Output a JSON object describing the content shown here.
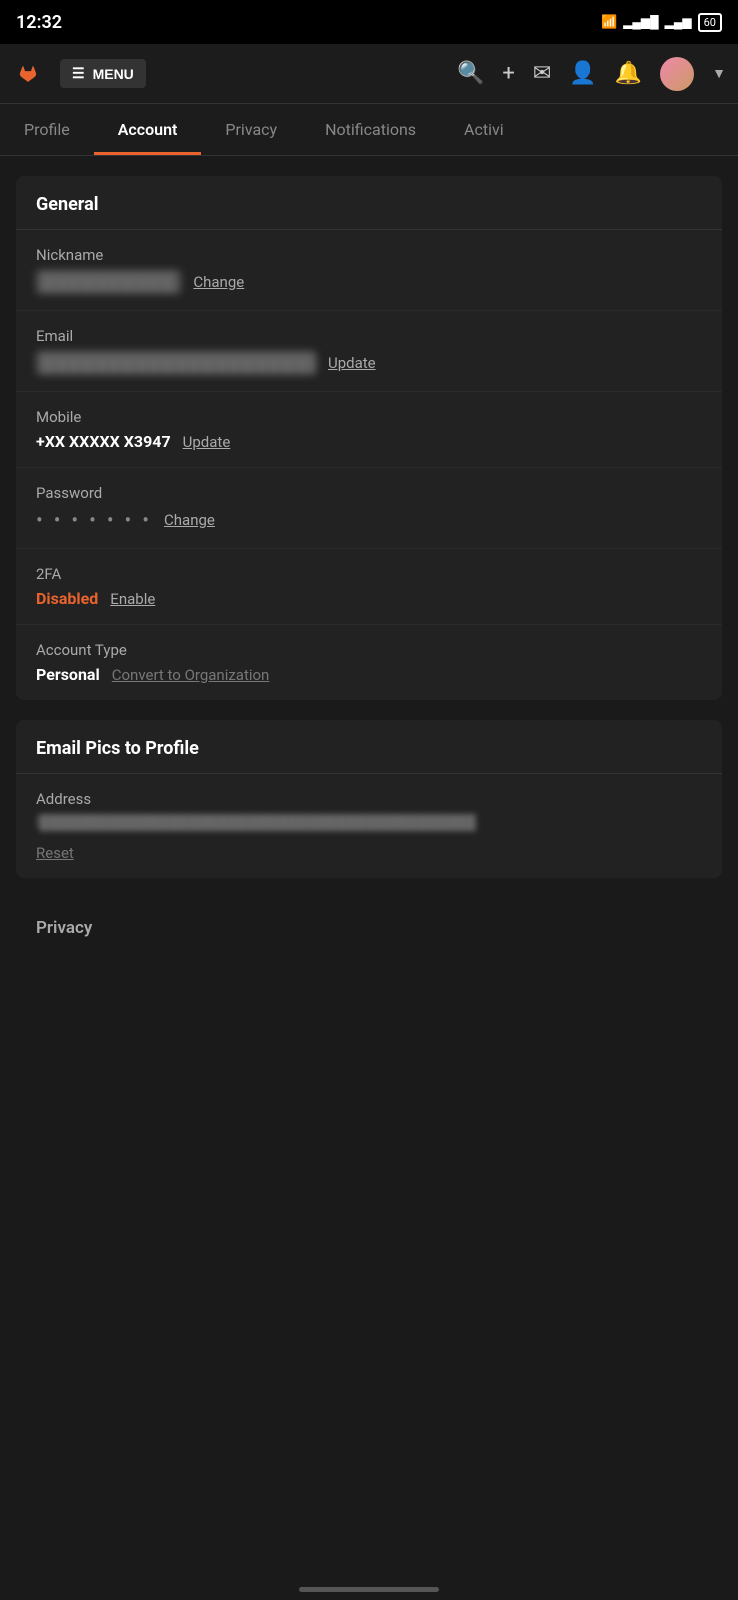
{
  "statusBar": {
    "time": "12:32",
    "battery": "60"
  },
  "topNav": {
    "menuLabel": "MENU",
    "logoAlt": "GitLab logo"
  },
  "tabs": [
    {
      "id": "profile",
      "label": "Profile",
      "active": false
    },
    {
      "id": "account",
      "label": "Account",
      "active": true
    },
    {
      "id": "privacy",
      "label": "Privacy",
      "active": false
    },
    {
      "id": "notifications",
      "label": "Notifications",
      "active": false
    },
    {
      "id": "activity",
      "label": "Activi",
      "active": false
    }
  ],
  "generalSection": {
    "header": "General",
    "fields": {
      "nickname": {
        "label": "Nickname",
        "value": "••••••••",
        "action": "Change"
      },
      "email": {
        "label": "Email",
        "value": "██████████████████████████",
        "action": "Update"
      },
      "mobile": {
        "label": "Mobile",
        "value": "+XX XXXXX X3947",
        "action": "Update"
      },
      "password": {
        "label": "Password",
        "value": "•••••••",
        "action": "Change"
      },
      "twofa": {
        "label": "2FA",
        "status": "Disabled",
        "action": "Enable"
      },
      "accountType": {
        "label": "Account Type",
        "value": "Personal",
        "action": "Convert to Organization"
      }
    }
  },
  "emailPicsSection": {
    "header": "Email Pics to Profile",
    "addressLabel": "Address",
    "addressValue": "█████████████████████████████████████",
    "resetLabel": "Reset"
  },
  "privacySection": {
    "label": "Privacy"
  }
}
